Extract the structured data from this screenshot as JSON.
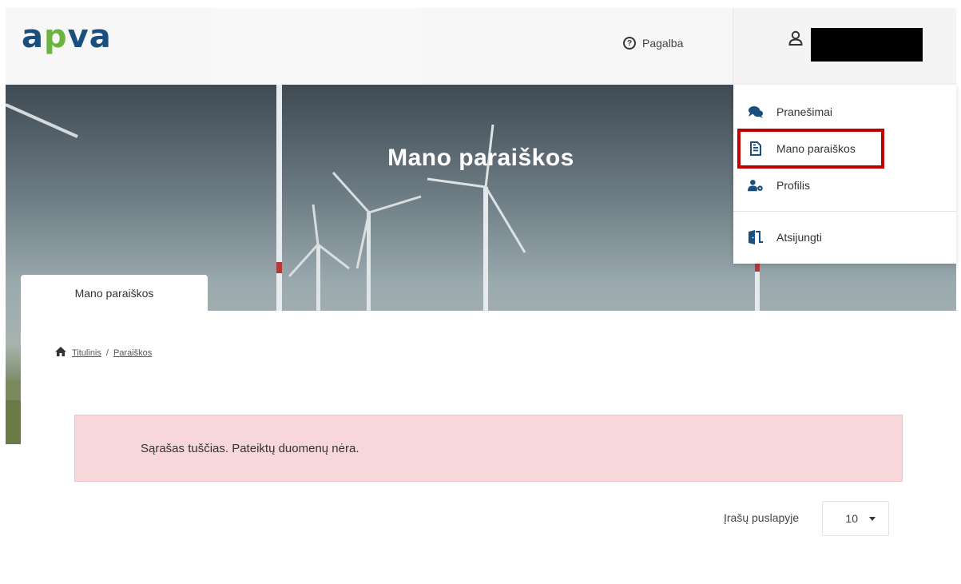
{
  "header": {
    "logo_prefix": "a",
    "logo_p": "p",
    "logo_suffix": "va",
    "help_label": "Pagalba",
    "help_icon_glyph": "?"
  },
  "hero": {
    "title": "Mano paraiškos"
  },
  "tabs": [
    {
      "label": "Mano paraiškos"
    }
  ],
  "breadcrumb": {
    "separator": "/",
    "items": [
      {
        "label": "Titulinis",
        "icon": "home-icon"
      },
      {
        "label": "Paraiškos"
      }
    ]
  },
  "alert": {
    "message": "Sąrašas tuščias. Pateiktų duomenų nėra."
  },
  "pagination": {
    "per_page_label": "Įrašų puslapyje",
    "per_page_value": "10"
  },
  "user_menu": {
    "items": [
      {
        "label": "Pranešimai",
        "icon": "comments-icon"
      },
      {
        "label": "Mano paraiškos",
        "icon": "document-icon"
      },
      {
        "label": "Profilis",
        "icon": "user-settings-icon"
      },
      {
        "label": "Atsijungti",
        "icon": "door-exit-icon"
      }
    ]
  },
  "colors": {
    "logo_blue": "#1a4e7e",
    "logo_green": "#6cb33f",
    "alert_bg": "#f8d7da",
    "highlight": "#c00000",
    "menu_icon": "#1a4e7e"
  }
}
